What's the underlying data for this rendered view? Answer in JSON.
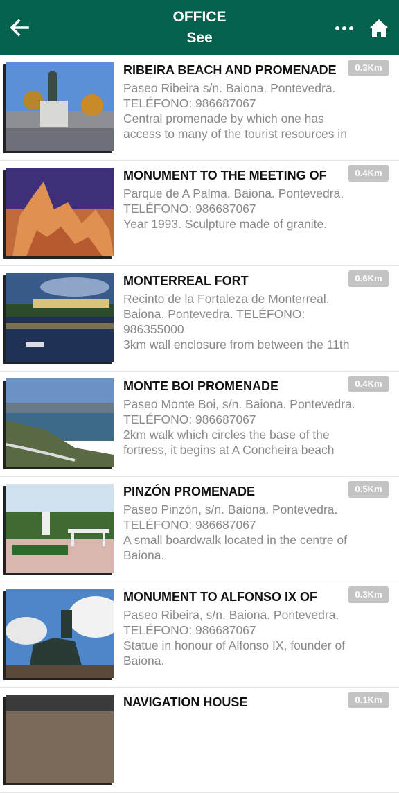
{
  "header": {
    "title_line1": "OFFICE",
    "title_line2": "See",
    "back_icon": "arrow-left-icon",
    "more_icon": "more-horizontal-icon",
    "home_icon": "home-icon"
  },
  "colors": {
    "appbar": "#04614d",
    "badge": "#c4c4c4",
    "muted": "#8a8a8a"
  },
  "items": [
    {
      "name": "RIBEIRA BEACH AND PROMENADE",
      "distance": "0.3Km",
      "lines": [
        "Paseo Ribeira s/n. Baiona. Pontevedra.",
        "TELÉFONO: 986687067",
        "Central promenade by which one has",
        "access to many of the tourist resources in"
      ]
    },
    {
      "name": "MONUMENT TO THE MEETING OF",
      "distance": "0.4Km",
      "lines": [
        "Parque de A Palma. Baiona. Pontevedra.",
        "TELÉFONO: 986687067",
        "Year 1993. Sculpture made of granite.",
        ""
      ]
    },
    {
      "name": "MONTERREAL FORT",
      "distance": "0.6Km",
      "lines": [
        "Recinto de la Fortaleza de Monterreal.",
        "Baiona. Pontevedra. TELÉFONO:",
        "986355000",
        "3km wall enclosure from between the 11th"
      ]
    },
    {
      "name": "MONTE BOI PROMENADE",
      "distance": "0.4Km",
      "lines": [
        "Paseo Monte Boi, s/n. Baiona. Pontevedra.",
        "TELÉFONO: 986687067",
        "2km walk which circles the base of the",
        "fortress, it begins at A Concheira beach"
      ]
    },
    {
      "name": "PINZÓN PROMENADE",
      "distance": "0.5Km",
      "lines": [
        "Paseo Pinzón, s/n. Baiona. Pontevedra.",
        "TELÉFONO: 986687067",
        "A small boardwalk located in the centre of",
        "Baiona."
      ]
    },
    {
      "name": "MONUMENT TO ALFONSO IX OF",
      "distance": "0.3Km",
      "lines": [
        "Paseo Ribeira, s/n. Baiona. Pontevedra.",
        "TELÉFONO: 986687067",
        "Statue in honour of Alfonso IX, founder of",
        "Baiona."
      ]
    },
    {
      "name": "NAVIGATION HOUSE",
      "distance": "0.1Km",
      "lines": [
        "",
        "",
        "",
        ""
      ]
    }
  ]
}
